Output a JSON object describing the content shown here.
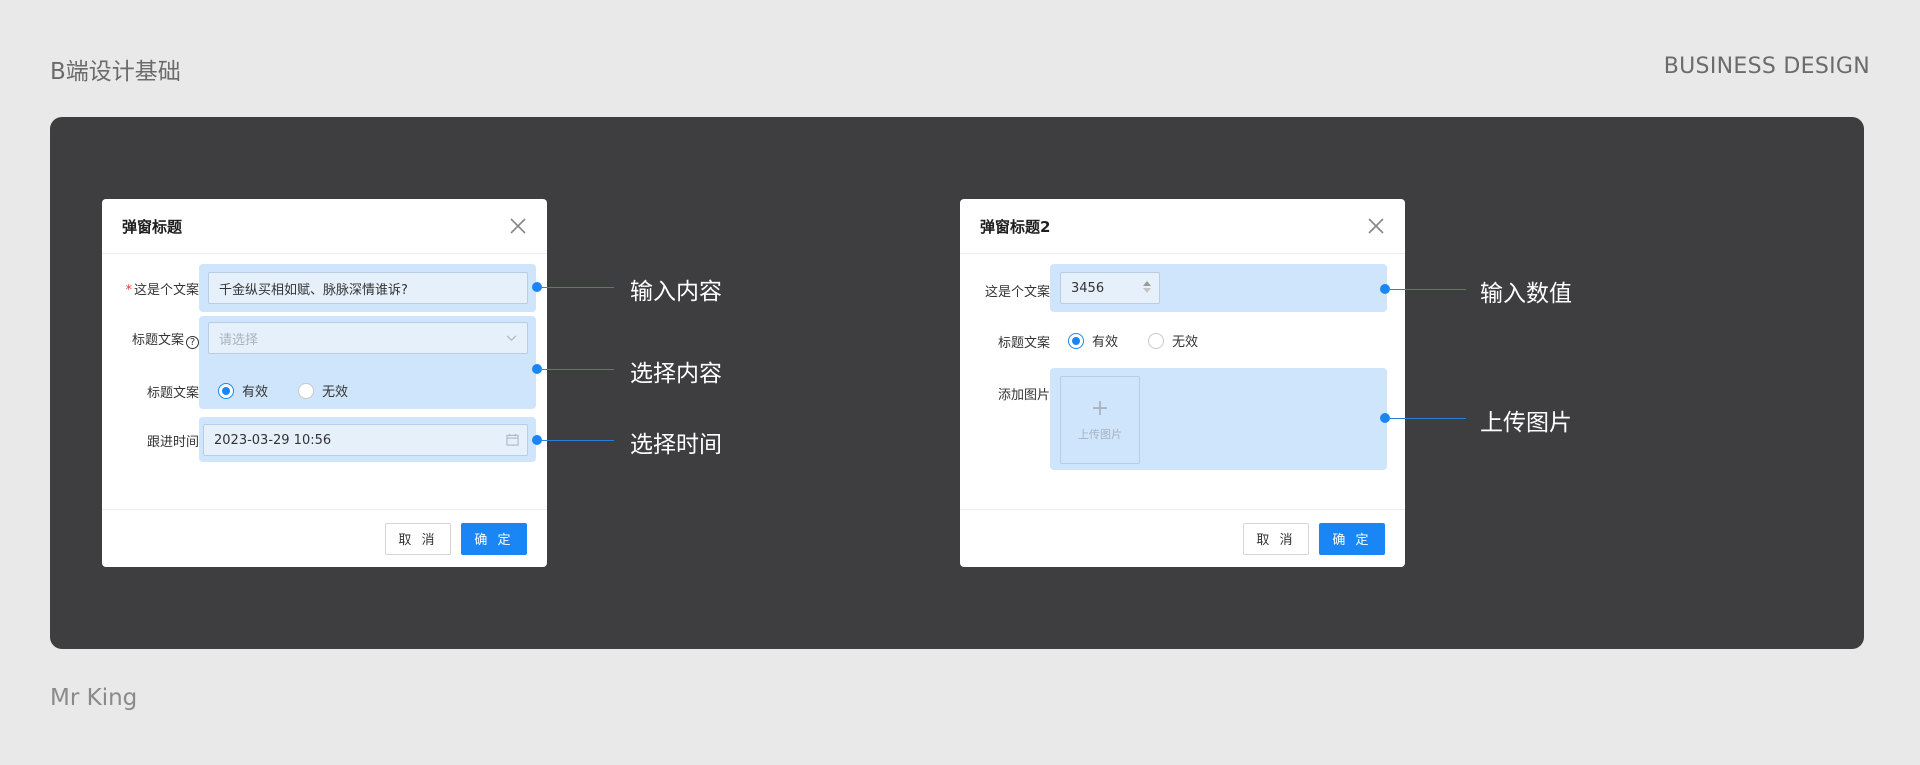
{
  "header": {
    "brand_cn": "B端设计基础",
    "brand_en": "BUSINESS DESIGN"
  },
  "footer": {
    "author": "Mr King"
  },
  "colors": {
    "accent": "#1a86f5",
    "highlight": "#cfe5fb",
    "stage": "#3e3e40",
    "page": "#e9e9e9"
  },
  "modal_left": {
    "title": "弹窗标题",
    "required_mark": "*",
    "field1": {
      "label": "这是个文案",
      "value": "千金纵买相如赋、脉脉深情谁诉?"
    },
    "field2": {
      "label": "标题文案",
      "help": "?",
      "placeholder": "请选择"
    },
    "field3": {
      "label": "标题文案",
      "options": [
        "有效",
        "无效"
      ],
      "selected": "有效"
    },
    "field4": {
      "label": "跟进时间",
      "value": "2023-03-29  10:56"
    },
    "cancel_label": "取 消",
    "ok_label": "确 定"
  },
  "modal_right": {
    "title": "弹窗标题2",
    "field1": {
      "label": "这是个文案",
      "value": "3456"
    },
    "field2": {
      "label": "标题文案",
      "options": [
        "有效",
        "无效"
      ],
      "selected": "有效"
    },
    "field3": {
      "label": "添加图片",
      "upload_text": "上传图片",
      "upload_plus": "+"
    },
    "cancel_label": "取 消",
    "ok_label": "确 定"
  },
  "callouts": {
    "input_content": "输入内容",
    "select_content": "选择内容",
    "select_time": "选择时间",
    "input_number": "输入数值",
    "upload_image": "上传图片"
  }
}
